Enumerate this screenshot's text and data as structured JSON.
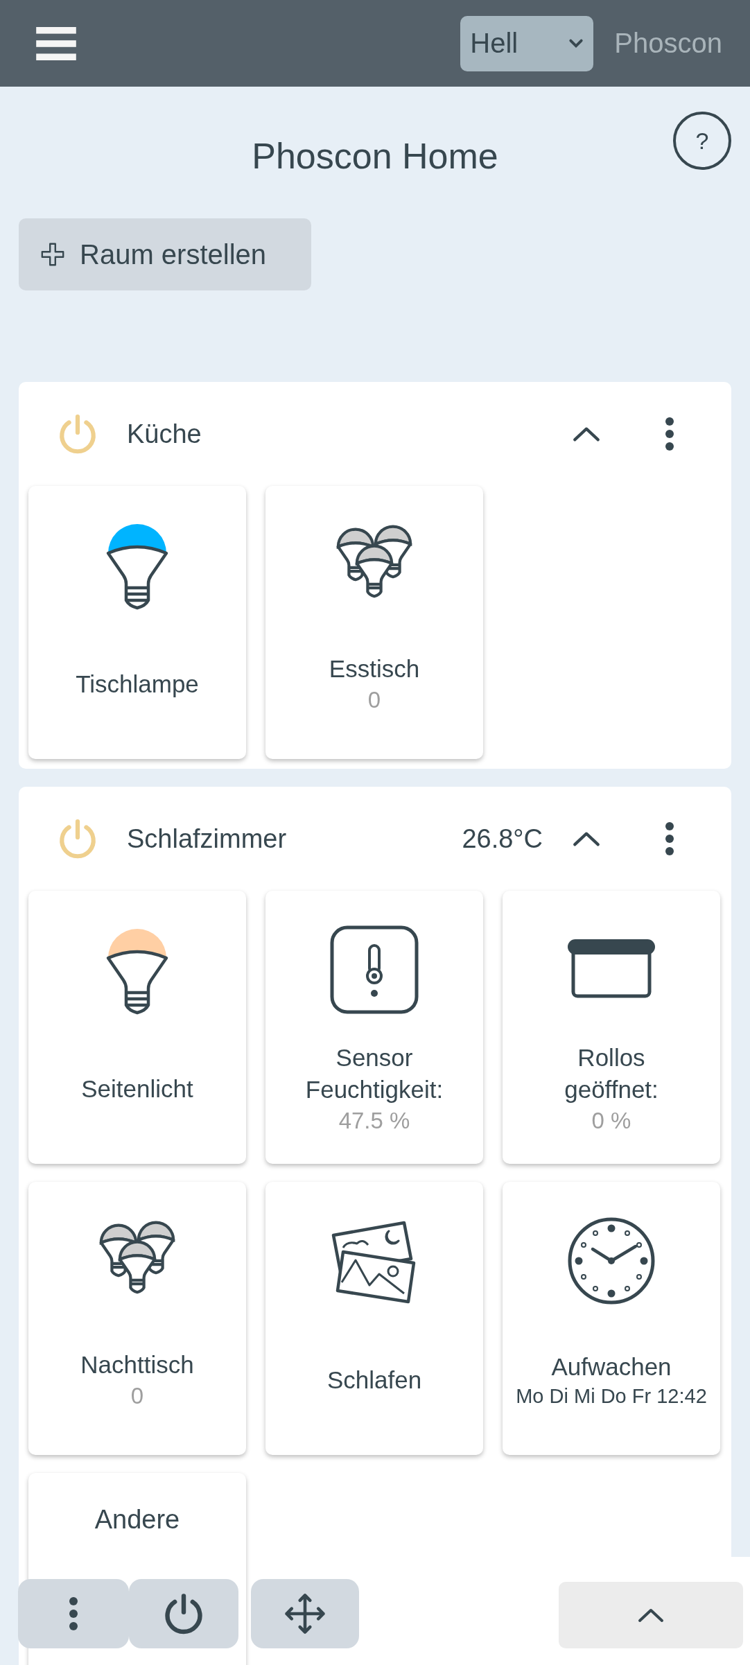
{
  "top_bar": {
    "theme_select": {
      "value": "Hell"
    },
    "brand": "Phoscon"
  },
  "title": "Phoscon Home",
  "help": "?",
  "create_room_button": {
    "label": "Raum erstellen"
  },
  "rooms": [
    {
      "name": "Küche",
      "on": true,
      "expanded": true,
      "tiles": [
        {
          "kind": "light",
          "name": "Tischlampe",
          "color": "#00b4ff"
        },
        {
          "kind": "group",
          "name": "Esstisch",
          "value": "0"
        }
      ]
    },
    {
      "name": "Schlafzimmer",
      "on": true,
      "temperature": "26.8°C",
      "expanded": true,
      "tiles": [
        {
          "kind": "light",
          "name": "Seitenlicht",
          "color": "#ffcfa4"
        },
        {
          "kind": "sensor",
          "name": "Sensor",
          "detail": "Feuchtigkeit:",
          "value": "47.5 %"
        },
        {
          "kind": "blind",
          "name": "Rollos",
          "detail": "geöffnet:",
          "value": "0 %"
        },
        {
          "kind": "group",
          "name": "Nachttisch",
          "value": "0"
        },
        {
          "kind": "scene",
          "name": "Schlafen"
        },
        {
          "kind": "schedule",
          "name": "Aufwachen",
          "detail": "Mo Di Mi Do Fr 12:42"
        },
        {
          "kind": "other",
          "name": "Andere"
        }
      ]
    }
  ]
}
